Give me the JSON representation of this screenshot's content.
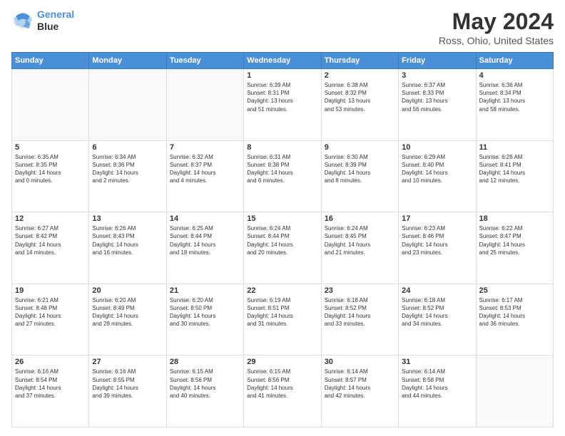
{
  "header": {
    "logo_line1": "General",
    "logo_line2": "Blue",
    "title": "May 2024",
    "subtitle": "Ross, Ohio, United States"
  },
  "days_of_week": [
    "Sunday",
    "Monday",
    "Tuesday",
    "Wednesday",
    "Thursday",
    "Friday",
    "Saturday"
  ],
  "weeks": [
    [
      {
        "day": "",
        "info": ""
      },
      {
        "day": "",
        "info": ""
      },
      {
        "day": "",
        "info": ""
      },
      {
        "day": "1",
        "info": "Sunrise: 6:39 AM\nSunset: 8:31 PM\nDaylight: 13 hours\nand 51 minutes."
      },
      {
        "day": "2",
        "info": "Sunrise: 6:38 AM\nSunset: 8:32 PM\nDaylight: 13 hours\nand 53 minutes."
      },
      {
        "day": "3",
        "info": "Sunrise: 6:37 AM\nSunset: 8:33 PM\nDaylight: 13 hours\nand 56 minutes."
      },
      {
        "day": "4",
        "info": "Sunrise: 6:36 AM\nSunset: 8:34 PM\nDaylight: 13 hours\nand 58 minutes."
      }
    ],
    [
      {
        "day": "5",
        "info": "Sunrise: 6:35 AM\nSunset: 8:35 PM\nDaylight: 14 hours\nand 0 minutes."
      },
      {
        "day": "6",
        "info": "Sunrise: 6:34 AM\nSunset: 8:36 PM\nDaylight: 14 hours\nand 2 minutes."
      },
      {
        "day": "7",
        "info": "Sunrise: 6:32 AM\nSunset: 8:37 PM\nDaylight: 14 hours\nand 4 minutes."
      },
      {
        "day": "8",
        "info": "Sunrise: 6:31 AM\nSunset: 8:38 PM\nDaylight: 14 hours\nand 6 minutes."
      },
      {
        "day": "9",
        "info": "Sunrise: 6:30 AM\nSunset: 8:39 PM\nDaylight: 14 hours\nand 8 minutes."
      },
      {
        "day": "10",
        "info": "Sunrise: 6:29 AM\nSunset: 8:40 PM\nDaylight: 14 hours\nand 10 minutes."
      },
      {
        "day": "11",
        "info": "Sunrise: 6:28 AM\nSunset: 8:41 PM\nDaylight: 14 hours\nand 12 minutes."
      }
    ],
    [
      {
        "day": "12",
        "info": "Sunrise: 6:27 AM\nSunset: 8:42 PM\nDaylight: 14 hours\nand 14 minutes."
      },
      {
        "day": "13",
        "info": "Sunrise: 6:26 AM\nSunset: 8:43 PM\nDaylight: 14 hours\nand 16 minutes."
      },
      {
        "day": "14",
        "info": "Sunrise: 6:25 AM\nSunset: 8:44 PM\nDaylight: 14 hours\nand 18 minutes."
      },
      {
        "day": "15",
        "info": "Sunrise: 6:24 AM\nSunset: 8:44 PM\nDaylight: 14 hours\nand 20 minutes."
      },
      {
        "day": "16",
        "info": "Sunrise: 6:24 AM\nSunset: 8:45 PM\nDaylight: 14 hours\nand 21 minutes."
      },
      {
        "day": "17",
        "info": "Sunrise: 6:23 AM\nSunset: 8:46 PM\nDaylight: 14 hours\nand 23 minutes."
      },
      {
        "day": "18",
        "info": "Sunrise: 6:22 AM\nSunset: 8:47 PM\nDaylight: 14 hours\nand 25 minutes."
      }
    ],
    [
      {
        "day": "19",
        "info": "Sunrise: 6:21 AM\nSunset: 8:48 PM\nDaylight: 14 hours\nand 27 minutes."
      },
      {
        "day": "20",
        "info": "Sunrise: 6:20 AM\nSunset: 8:49 PM\nDaylight: 14 hours\nand 28 minutes."
      },
      {
        "day": "21",
        "info": "Sunrise: 6:20 AM\nSunset: 8:50 PM\nDaylight: 14 hours\nand 30 minutes."
      },
      {
        "day": "22",
        "info": "Sunrise: 6:19 AM\nSunset: 8:51 PM\nDaylight: 14 hours\nand 31 minutes."
      },
      {
        "day": "23",
        "info": "Sunrise: 6:18 AM\nSunset: 8:52 PM\nDaylight: 14 hours\nand 33 minutes."
      },
      {
        "day": "24",
        "info": "Sunrise: 6:18 AM\nSunset: 8:52 PM\nDaylight: 14 hours\nand 34 minutes."
      },
      {
        "day": "25",
        "info": "Sunrise: 6:17 AM\nSunset: 8:53 PM\nDaylight: 14 hours\nand 36 minutes."
      }
    ],
    [
      {
        "day": "26",
        "info": "Sunrise: 6:16 AM\nSunset: 8:54 PM\nDaylight: 14 hours\nand 37 minutes."
      },
      {
        "day": "27",
        "info": "Sunrise: 6:16 AM\nSunset: 8:55 PM\nDaylight: 14 hours\nand 39 minutes."
      },
      {
        "day": "28",
        "info": "Sunrise: 6:15 AM\nSunset: 8:56 PM\nDaylight: 14 hours\nand 40 minutes."
      },
      {
        "day": "29",
        "info": "Sunrise: 6:15 AM\nSunset: 8:56 PM\nDaylight: 14 hours\nand 41 minutes."
      },
      {
        "day": "30",
        "info": "Sunrise: 6:14 AM\nSunset: 8:57 PM\nDaylight: 14 hours\nand 42 minutes."
      },
      {
        "day": "31",
        "info": "Sunrise: 6:14 AM\nSunset: 8:58 PM\nDaylight: 14 hours\nand 44 minutes."
      },
      {
        "day": "",
        "info": ""
      }
    ]
  ]
}
